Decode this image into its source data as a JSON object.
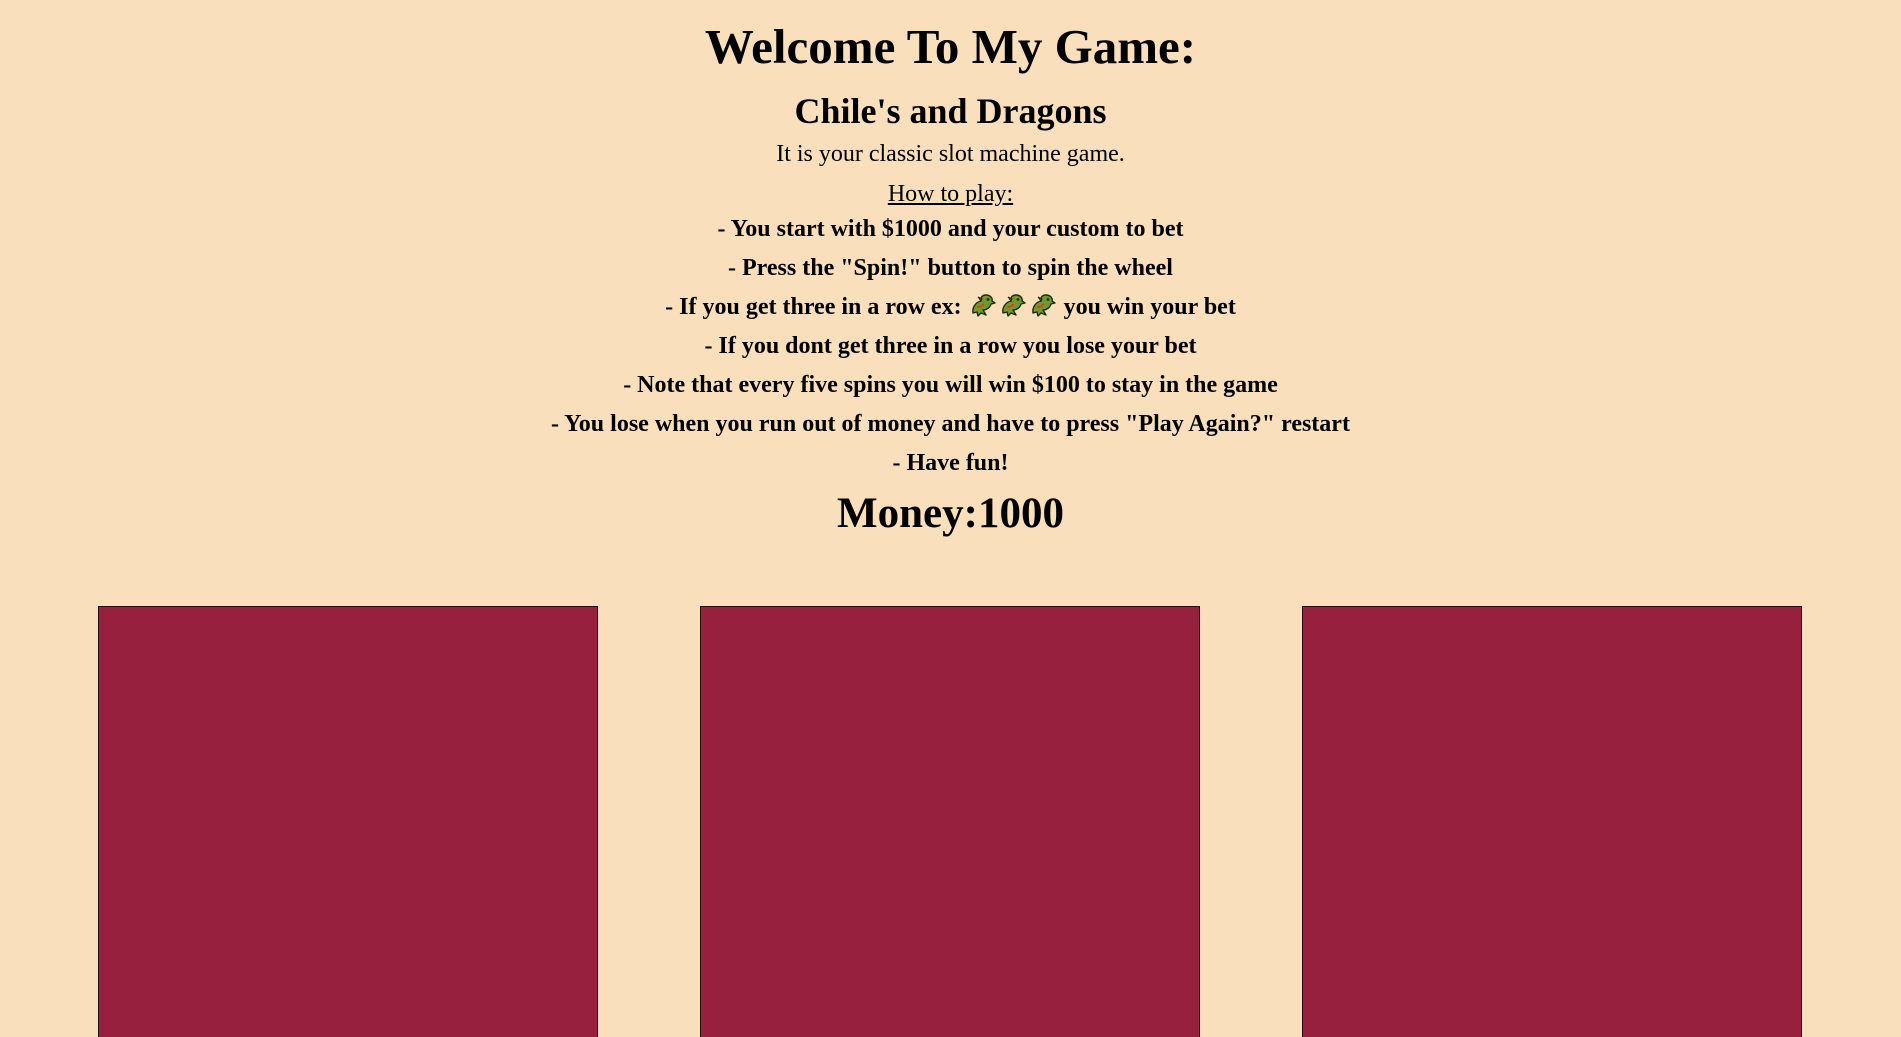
{
  "header": {
    "title": "Welcome To My Game:",
    "subtitle": "Chile's and Dragons",
    "intro": "It is your classic slot machine game.",
    "how_to_label": "How to play:"
  },
  "rules": {
    "r1": "- You start with $1000 and your custom to bet",
    "r2": "- Press the \"Spin!\" button to spin the wheel",
    "r3_prefix": "- If you get three in a row ex:",
    "r3_suffix": "you win your bet",
    "r3_example_icons": [
      "dragon-icon",
      "dragon-icon",
      "dragon-icon"
    ],
    "r4": "- If you dont get three in a row you lose your bet",
    "r5": "- Note that every five spins you will win $100 to stay in the game",
    "r6": "- You lose when you run out of money and have to press \"Play Again?\" restart",
    "r7": "- Have fun!"
  },
  "money": {
    "label": "Money:",
    "value": "1000"
  },
  "reels": {
    "count": 3,
    "color": "#96203d"
  },
  "colors": {
    "background": "#f9dfbb",
    "reel": "#96203d"
  }
}
